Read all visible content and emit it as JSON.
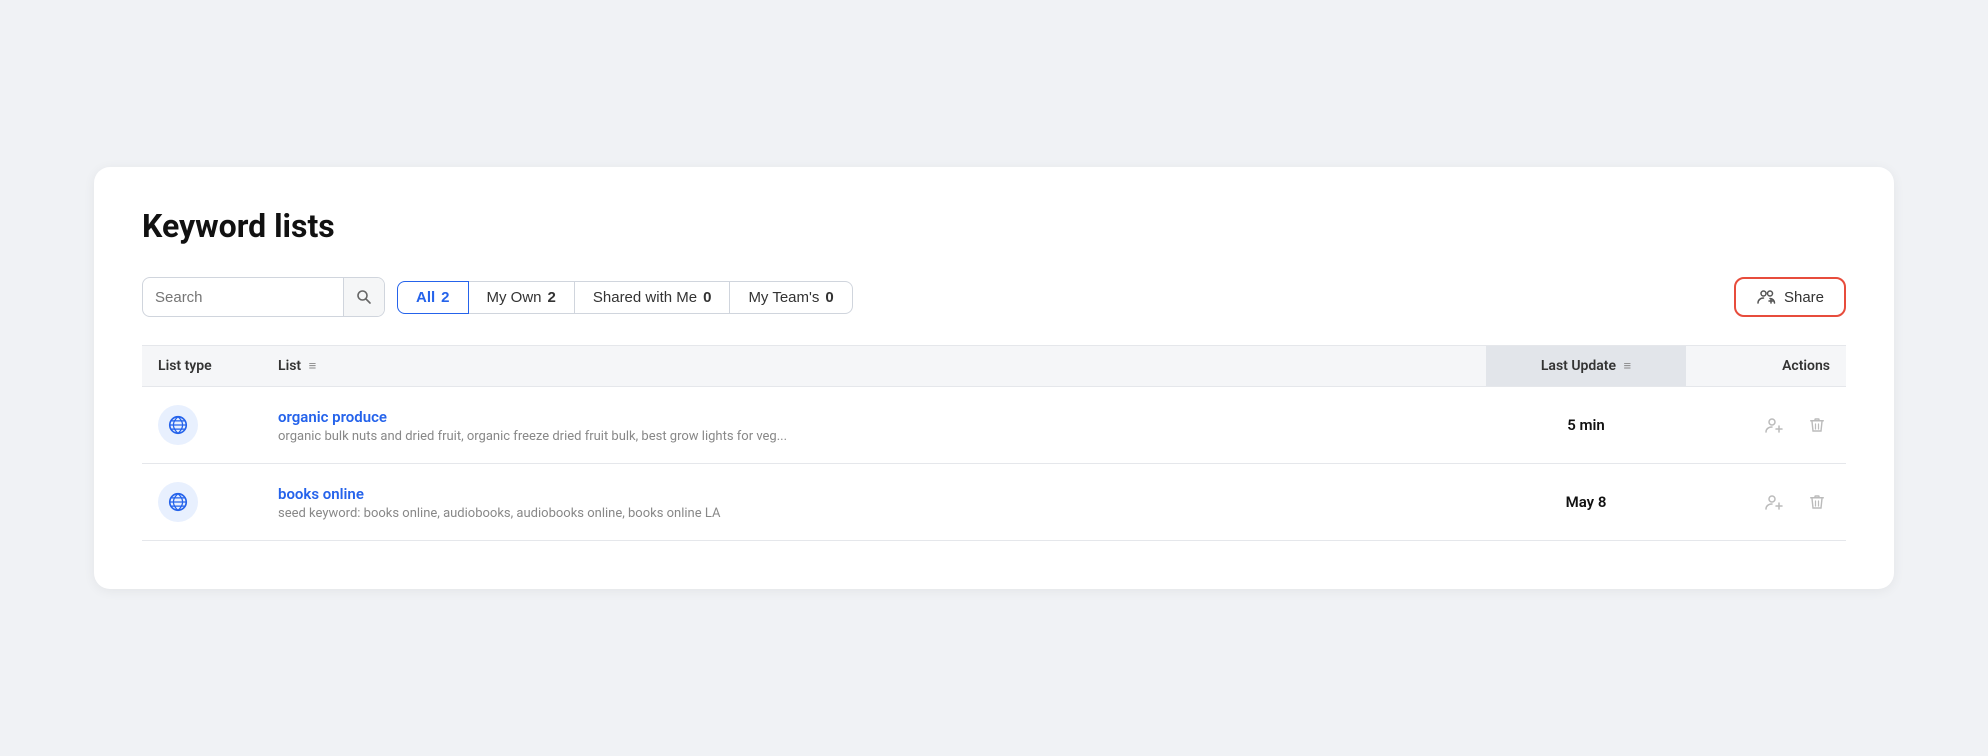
{
  "page": {
    "title": "Keyword lists"
  },
  "search": {
    "placeholder": "Search",
    "value": ""
  },
  "filters": [
    {
      "id": "all",
      "label": "All",
      "count": 2,
      "active": true
    },
    {
      "id": "my-own",
      "label": "My Own",
      "count": 2,
      "active": false
    },
    {
      "id": "shared-with-me",
      "label": "Shared with Me",
      "count": 0,
      "active": false
    },
    {
      "id": "my-teams",
      "label": "My Team's",
      "count": 0,
      "active": false
    }
  ],
  "share_button": "Share",
  "table": {
    "headers": {
      "list_type": "List type",
      "list": "List",
      "last_update": "Last Update",
      "actions": "Actions"
    },
    "rows": [
      {
        "id": "organic-produce",
        "name": "organic produce",
        "description": "organic bulk nuts and dried fruit, organic freeze dried fruit bulk, best grow lights for veg...",
        "last_update": "5 min"
      },
      {
        "id": "books-online",
        "name": "books online",
        "description": "seed keyword: books online, audiobooks, audiobooks online, books online LA",
        "last_update": "May 8"
      }
    ]
  }
}
